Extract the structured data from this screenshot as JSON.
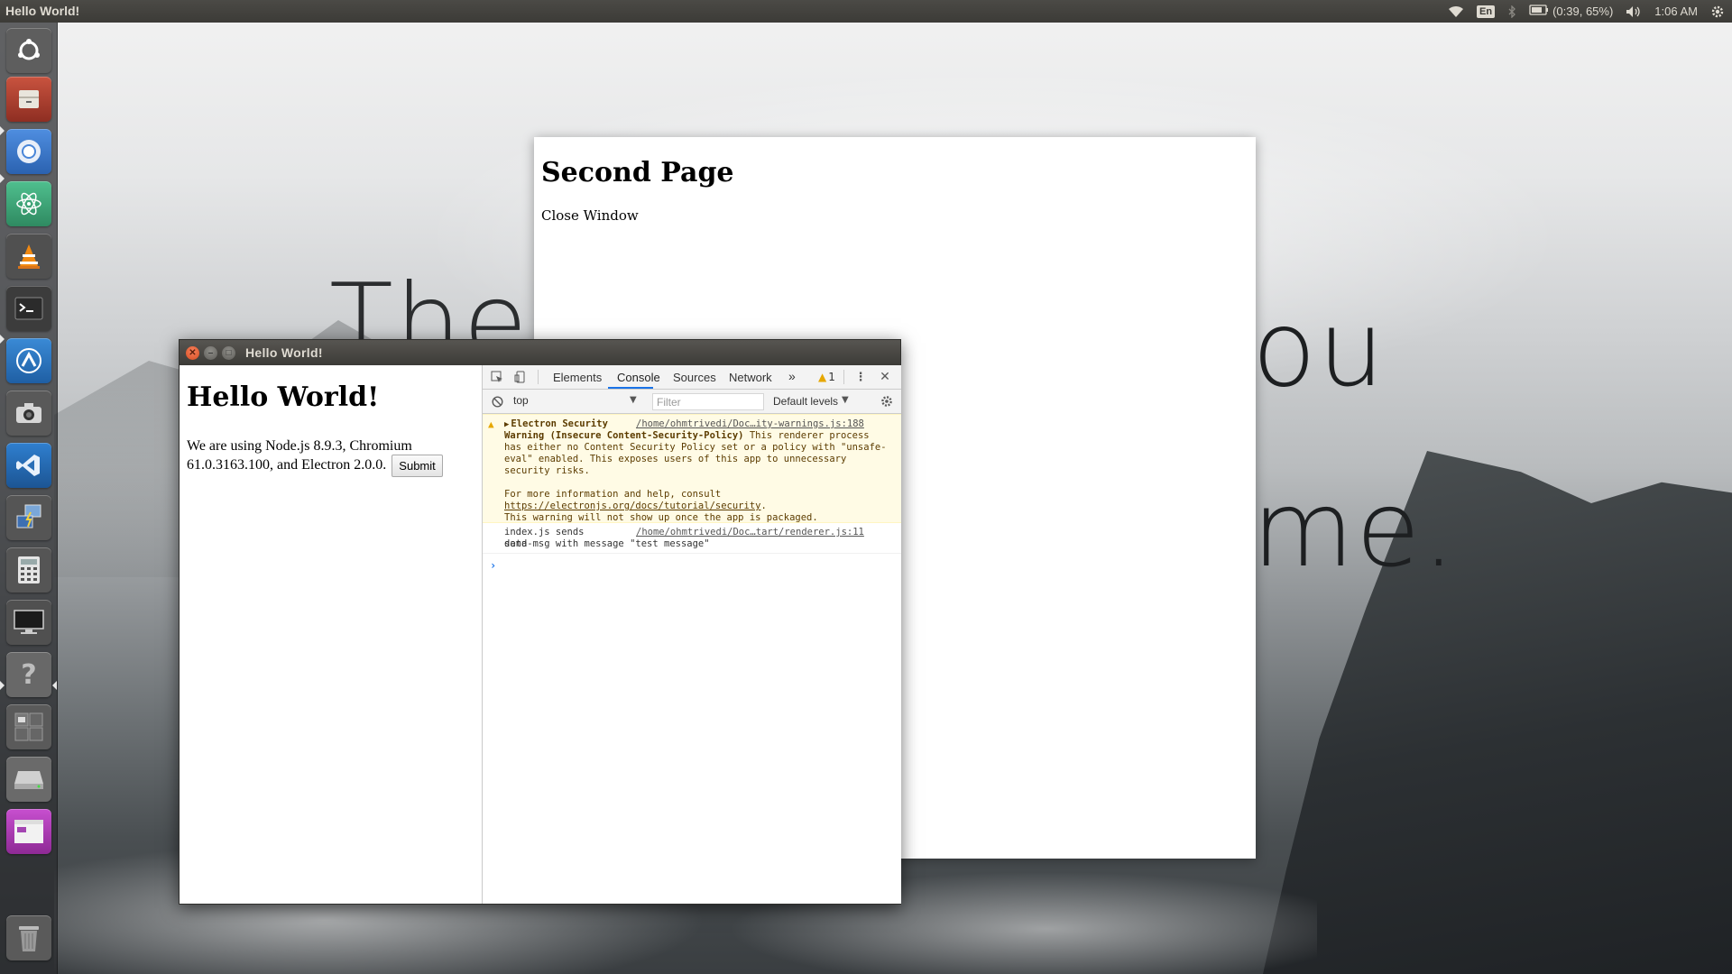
{
  "desktop": {
    "wallpaper_words": [
      "The",
      "ou",
      "me."
    ]
  },
  "top_panel": {
    "title": "Hello World!",
    "language": "En",
    "battery": "(0:39, 65%)",
    "time": "1:06 AM",
    "icons": [
      "wifi-icon",
      "bluetooth-icon",
      "battery-icon",
      "volume-icon",
      "settings-gear-icon"
    ]
  },
  "launcher": {
    "items": [
      {
        "name": "ubuntu-dash",
        "icon": "ubuntu-logo-icon",
        "color": "#5e5e5e"
      },
      {
        "name": "files",
        "icon": "file-cabinet-icon",
        "color": "#b5473b"
      },
      {
        "name": "chromium",
        "icon": "chromium-icon",
        "color": "#3a7bd5"
      },
      {
        "name": "atom",
        "icon": "atom-icon",
        "color": "#3aa57a"
      },
      {
        "name": "vlc",
        "icon": "vlc-cone-icon",
        "color": "#505050"
      },
      {
        "name": "terminal",
        "icon": "terminal-icon",
        "color": "#3c3c3c"
      },
      {
        "name": "arduino",
        "icon": "arrow-up-logo-icon",
        "color": "#2d7ac4"
      },
      {
        "name": "camera",
        "icon": "camera-icon",
        "color": "#595959"
      },
      {
        "name": "vscode",
        "icon": "vscode-icon",
        "color": "#2a6fb7"
      },
      {
        "name": "remote-desktop",
        "icon": "remote-desktop-icon",
        "color": "#555555"
      },
      {
        "name": "calculator",
        "icon": "calculator-icon",
        "color": "#555555"
      },
      {
        "name": "display",
        "icon": "monitor-icon",
        "color": "#505050"
      },
      {
        "name": "help",
        "icon": "question-mark-icon",
        "color": "#686868"
      },
      {
        "name": "workspaces",
        "icon": "workspace-switcher-icon",
        "color": "#5a5a5a"
      },
      {
        "name": "drive",
        "icon": "hard-drive-icon",
        "color": "#6a6a6a"
      },
      {
        "name": "electron-app",
        "icon": "app-window-icon",
        "color": "#b03fb5"
      },
      {
        "name": "trash",
        "icon": "trash-icon",
        "color": "#5a5a5a"
      }
    ]
  },
  "second_window": {
    "heading": "Second Page",
    "link_text": "Close Window"
  },
  "hello_window": {
    "title": "Hello World!",
    "heading": "Hello World!",
    "paragraph": "We are using Node.js 8.9.3, Chromium 61.0.3163.100, and Electron 2.0.0.",
    "submit_label": "Submit"
  },
  "devtools": {
    "tabs": [
      "Elements",
      "Console",
      "Sources",
      "Network"
    ],
    "active_tab": "Console",
    "more_tabs": "»",
    "warning_count": "1",
    "context": "top",
    "filter_placeholder": "Filter",
    "levels": "Default levels",
    "messages": {
      "warning": {
        "title": "Electron Security",
        "source": "/home/ohmtrivedi/Doc…ity-warnings.js:188",
        "bold_prefix": "Warning (Insecure Content-Security-Policy)",
        "body": " This renderer process has either no Content Security Policy set or a policy with \"unsafe-eval\" enabled. This exposes users of this app to unnecessary security risks.",
        "help_prefix": "For more information and help, consult ",
        "help_link": "https://electronjs.org/docs/tutorial/security",
        "footer": "This warning will not show up once the app is packaged."
      },
      "log": {
        "line1": "index.js sends send-",
        "line2": "data msg with message \"test message\"",
        "source": "/home/ohmtrivedi/Doc…tart/renderer.js:11"
      }
    },
    "prompt": "›"
  }
}
